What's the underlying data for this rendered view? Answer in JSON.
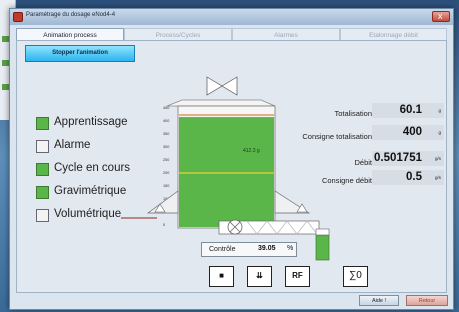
{
  "window": {
    "title": "Paramétrage du dosage eNod4-4",
    "close_label": "x"
  },
  "tabs": [
    {
      "label": "Animation process",
      "active": true
    },
    {
      "label": "Process/Cycles",
      "active": false
    },
    {
      "label": "Alarmes",
      "active": false
    },
    {
      "label": "Etalonnage débit",
      "active": false
    }
  ],
  "toolbar": {
    "stop_label": "Stopper l'animation"
  },
  "status_items": [
    {
      "label": "Apprentissage",
      "checked": true
    },
    {
      "label": "Alarme",
      "checked": false
    },
    {
      "label": "Cycle en cours",
      "checked": true
    },
    {
      "label": "Gravimétrique",
      "checked": true
    },
    {
      "label": "Volumétrique",
      "checked": false
    }
  ],
  "hopper": {
    "weight_label": "412.3 g",
    "fill_level": 412.3,
    "scale_max": 450,
    "scale_ticks": [
      "450",
      "400",
      "350",
      "300",
      "250",
      "200",
      "150",
      "100",
      "50",
      "0"
    ]
  },
  "readouts": {
    "totalisation": {
      "label": "Totalisation",
      "value": "60.1",
      "unit": "g"
    },
    "consigne_totalisation": {
      "label": "Consigne totalisation",
      "value": "400",
      "unit": "g"
    },
    "debit": {
      "label": "Débit",
      "value": "0.501751",
      "unit": "g/s"
    },
    "consigne_debit": {
      "label": "Consigne débit",
      "value": "0.5",
      "unit": "g/s"
    }
  },
  "control": {
    "label": "Contrôle",
    "value": "39.05",
    "unit": "%"
  },
  "tool_buttons": [
    {
      "name": "stop-square-button",
      "label": "■"
    },
    {
      "name": "discharge-button",
      "label": "⇊"
    },
    {
      "name": "rf-button",
      "label": "RF"
    },
    {
      "name": "sum-reset-button",
      "label": "∑0"
    }
  ],
  "bottom": {
    "help_label": "Aide !",
    "back_label": "Retour"
  },
  "colors": {
    "accent_green": "#5bb64a",
    "stop_button": "#2bb4ee",
    "line_orange": "#d2873a",
    "line_yellow": "#e8d034"
  }
}
